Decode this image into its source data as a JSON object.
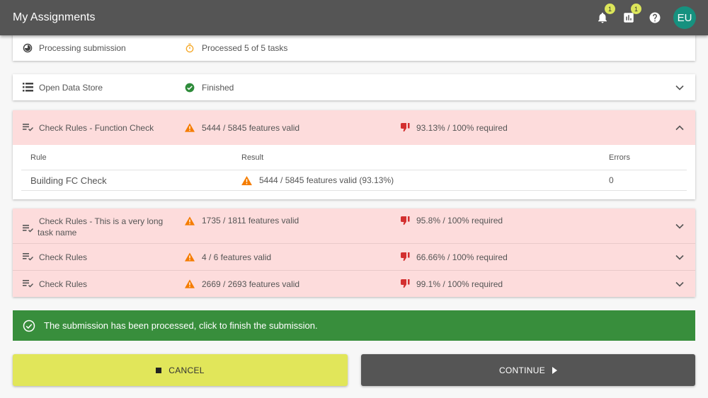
{
  "app": {
    "title": "My Assignments",
    "notifications_badge": "1",
    "stats_badge": "1",
    "avatar_initials": "EU",
    "colors": {
      "appbar": "#555555",
      "avatar": "#16917f",
      "badge": "#dce65a"
    }
  },
  "processing": {
    "label": "Processing submission",
    "status": "Processed 5 of 5 tasks"
  },
  "tasks": [
    {
      "name": "Open Data Store",
      "status": "Finished",
      "status_type": "success",
      "expanded": false
    },
    {
      "name": "Check Rules - Function Check",
      "status": "5444 / 5845 features valid",
      "requirement": "93.13% / 100% required",
      "status_type": "warning",
      "expanded": true,
      "table": {
        "headers": {
          "rule": "Rule",
          "result": "Result",
          "errors": "Errors"
        },
        "rows": [
          {
            "rule": "Building FC Check",
            "result": "5444 / 5845 features valid (93.13%)",
            "errors": "0"
          }
        ]
      }
    },
    {
      "name": "Check Rules - This is a very long task name",
      "status": "1735 / 1811 features valid",
      "requirement": "95.8% / 100% required",
      "status_type": "warning",
      "expanded": false
    },
    {
      "name": "Check Rules",
      "status": "4 / 6 features valid",
      "requirement": "66.66% / 100% required",
      "status_type": "warning",
      "expanded": false
    },
    {
      "name": "Check Rules",
      "status": "2669 / 2693 features valid",
      "requirement": "99.1% / 100% required",
      "status_type": "warning",
      "expanded": false
    }
  ],
  "banner": {
    "message": "The submission has been processed, click to finish the submission.",
    "color": "#388e3c"
  },
  "actions": {
    "cancel_label": "CANCEL",
    "continue_label": "CONTINUE",
    "cancel_color": "#e1e65a",
    "continue_color": "#555555"
  }
}
